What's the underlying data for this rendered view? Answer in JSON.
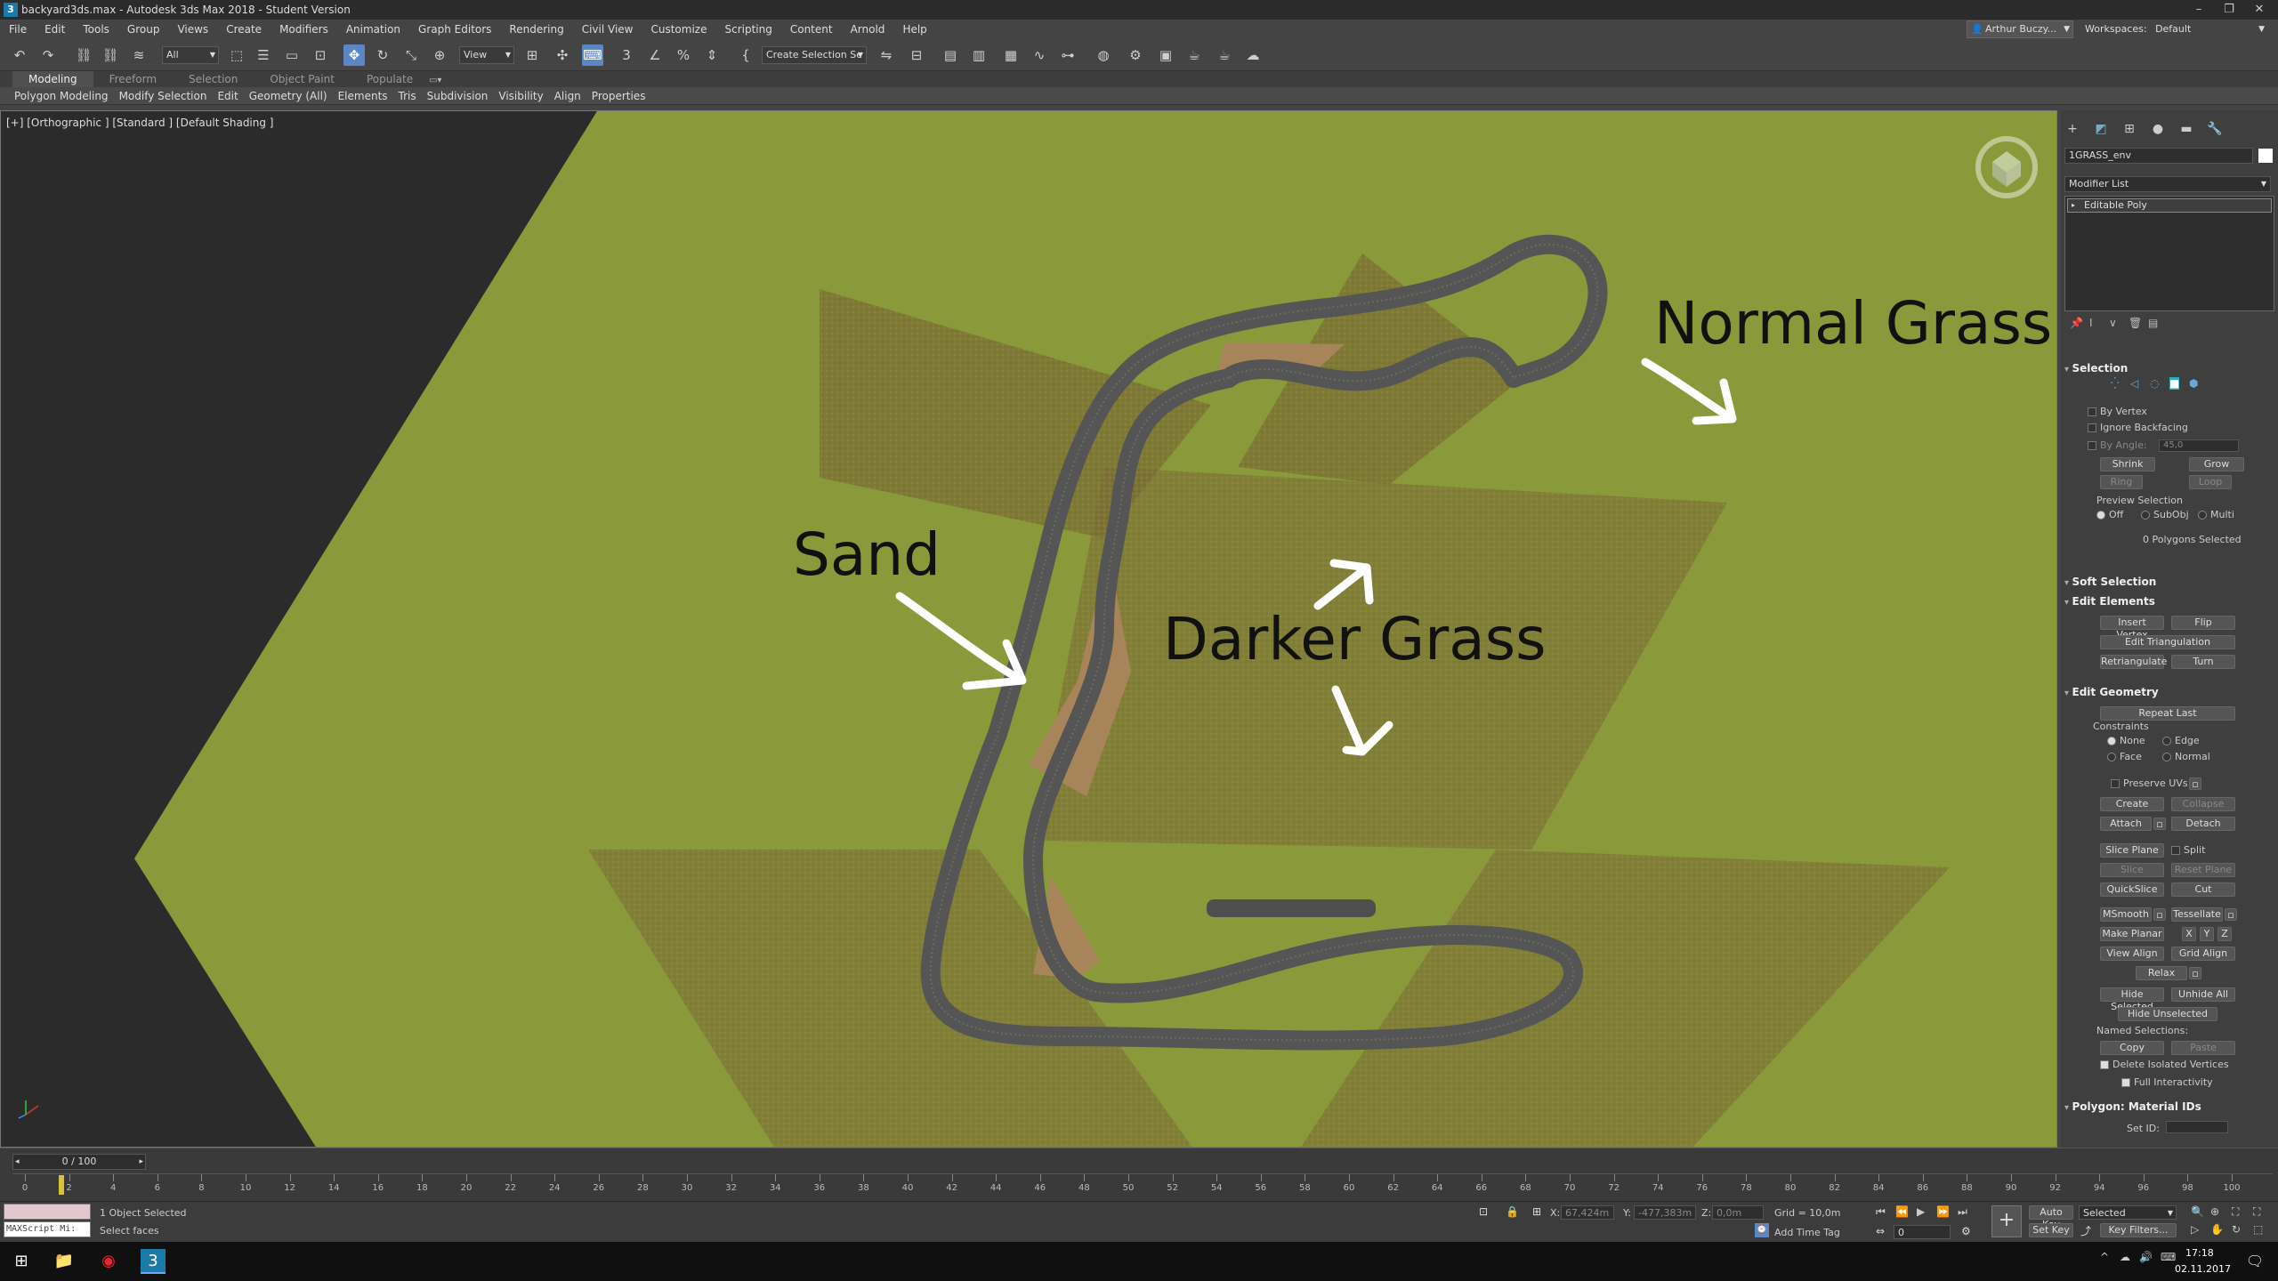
{
  "window": {
    "title": "backyard3ds.max - Autodesk 3ds Max 2018 - Student Version"
  },
  "menu": [
    "File",
    "Edit",
    "Tools",
    "Group",
    "Views",
    "Create",
    "Modifiers",
    "Animation",
    "Graph Editors",
    "Rendering",
    "Civil View",
    "Customize",
    "Scripting",
    "Content",
    "Arnold",
    "Help"
  ],
  "user": {
    "name": "Arthur Buczy..."
  },
  "workspaces": {
    "label": "Workspaces:",
    "value": "Default"
  },
  "toolbar": {
    "filter": "All",
    "ref_coord": "View",
    "selection_set": "Create Selection Se"
  },
  "ribbon_tabs": [
    "Modeling",
    "Freeform",
    "Selection",
    "Object Paint",
    "Populate"
  ],
  "ribbon_items": [
    "Polygon Modeling",
    "Modify Selection",
    "Edit",
    "Geometry (All)",
    "Elements",
    "Tris",
    "Subdivision",
    "Visibility",
    "Align",
    "Properties"
  ],
  "viewport": {
    "label": "[+] [Orthographic ] [Standard ] [Default Shading ]",
    "annotations": {
      "normal": "Normal Grass",
      "sand": "Sand",
      "darker": "Darker Grass"
    }
  },
  "panel": {
    "object_name": "1GRASS_env",
    "modifier_list": "Modifier List",
    "stack_item": "Editable Poly",
    "selection": {
      "title": "Selection",
      "by_vertex": "By Vertex",
      "ignore_backfacing": "Ignore Backfacing",
      "by_angle": "By Angle:",
      "angle": "45,0",
      "shrink": "Shrink",
      "grow": "Grow",
      "ring": "Ring",
      "loop": "Loop",
      "preview": "Preview Selection",
      "off": "Off",
      "subobj": "SubObj",
      "multi": "Multi",
      "status": "0 Polygons Selected"
    },
    "soft_selection": {
      "title": "Soft Selection"
    },
    "edit_elements": {
      "title": "Edit Elements",
      "insert_vertex": "Insert Vertex",
      "flip": "Flip",
      "edit_triangulation": "Edit Triangulation",
      "retriangulate": "Retriangulate",
      "turn": "Turn"
    },
    "edit_geometry": {
      "title": "Edit Geometry",
      "repeat_last": "Repeat Last",
      "constraints": "Constraints",
      "none": "None",
      "edge": "Edge",
      "face": "Face",
      "normal": "Normal",
      "preserve_uvs": "Preserve UVs",
      "create": "Create",
      "collapse": "Collapse",
      "attach": "Attach",
      "detach": "Detach",
      "slice_plane": "Slice Plane",
      "split": "Split",
      "slice": "Slice",
      "reset_plane": "Reset Plane",
      "quickslice": "QuickSlice",
      "cut": "Cut",
      "msmooth": "MSmooth",
      "tessellate": "Tessellate",
      "make_planar": "Make Planar",
      "x": "X",
      "y": "Y",
      "z": "Z",
      "view_align": "View Align",
      "grid_align": "Grid Align",
      "relax": "Relax",
      "hide_selected": "Hide Selected",
      "unhide_all": "Unhide All",
      "hide_unselected": "Hide Unselected",
      "named_selections": "Named Selections:",
      "copy": "Copy",
      "paste": "Paste",
      "delete_isolated": "Delete Isolated Vertices",
      "full_interactivity": "Full Interactivity"
    },
    "material_ids": {
      "title": "Polygon: Material IDs",
      "set_id": "Set ID:"
    }
  },
  "timeline": {
    "slider": "0 / 100",
    "ticks": [
      "0",
      "2",
      "4",
      "6",
      "8",
      "10",
      "12",
      "14",
      "16",
      "18",
      "20",
      "22",
      "24",
      "26",
      "28",
      "30",
      "32",
      "34",
      "36",
      "38",
      "40",
      "42",
      "44",
      "46",
      "48",
      "50",
      "52",
      "54",
      "56",
      "58",
      "60",
      "62",
      "64",
      "66",
      "68",
      "70",
      "72",
      "74",
      "76",
      "78",
      "80",
      "82",
      "84",
      "86",
      "88",
      "90",
      "92",
      "94",
      "96",
      "98",
      "100"
    ]
  },
  "status": {
    "maxscript": "MAXScript Mi:",
    "objects": "1 Object Selected",
    "prompt": "Select faces",
    "x_label": "X:",
    "x": "67,424m",
    "y_label": "Y:",
    "y": "-477,383m",
    "z_label": "Z:",
    "z": "0,0m",
    "grid": "Grid = 10,0m",
    "add_time_tag": "Add Time Tag",
    "auto_key": "Auto Key",
    "set_key": "Set Key",
    "selected": "Selected",
    "key_filters": "Key Filters...",
    "frame": "0"
  },
  "taskbar": {
    "time": "17:18",
    "date": "02.11.2017"
  },
  "colors": {
    "grass": "#8a9a3a",
    "dark_grass": "#6e6a2e",
    "sand": "#a8845a",
    "road": "#5e5e5e",
    "accent": "#5b88c4"
  }
}
